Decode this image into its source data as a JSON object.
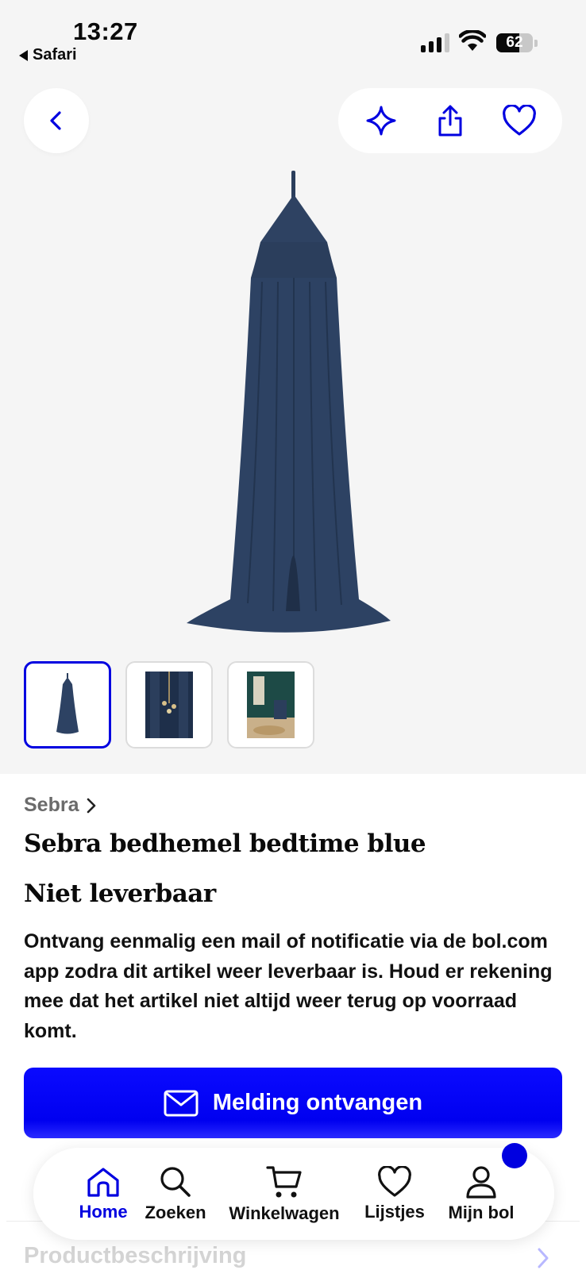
{
  "status_bar": {
    "time": "13:27",
    "back_app": "Safari",
    "battery": "62"
  },
  "toolbar": {
    "icons": [
      "back-chevron-icon",
      "sparkle-icon",
      "share-icon",
      "heart-icon"
    ]
  },
  "product": {
    "brand": "Sebra",
    "title": "Sebra bedhemel bedtime blue",
    "availability": "Niet leverbaar",
    "description": "Ontvang eenmalig een mail of notificatie via de bol.com app zodra dit artikel weer leverbaar is. Houd er rekening mee dat het artikel niet altijd weer terug op voorraad komt.",
    "cta_label": "Melding ontvangen",
    "section_label": "Productbeschrijving",
    "image_color": "#2b3e5c"
  },
  "tabbar": {
    "items": [
      {
        "label": "Home",
        "icon": "home-icon",
        "active": true
      },
      {
        "label": "Zoeken",
        "icon": "search-icon",
        "active": false
      },
      {
        "label": "Winkelwagen",
        "icon": "cart-icon",
        "active": false
      },
      {
        "label": "Lijstjes",
        "icon": "heart-icon",
        "active": false
      },
      {
        "label": "Mijn bol",
        "icon": "user-icon",
        "active": false
      }
    ]
  },
  "colors": {
    "accent": "#0000e0",
    "hero_bg": "#f5f5f5"
  }
}
